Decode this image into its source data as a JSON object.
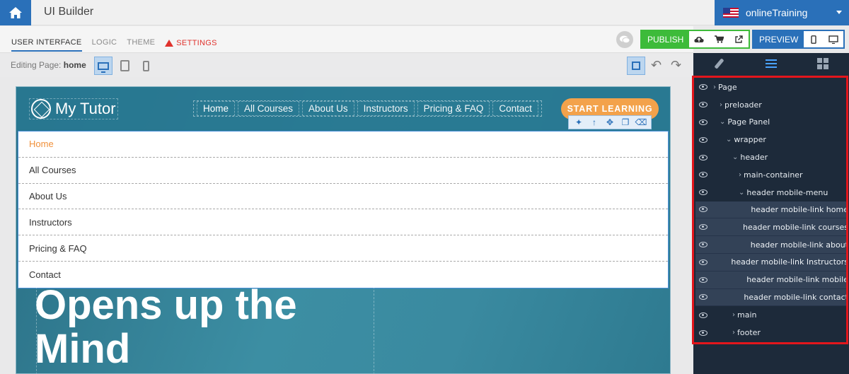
{
  "app": {
    "title": "UI Builder",
    "project": "onlineTraining"
  },
  "tabs": [
    {
      "label": "USER INTERFACE"
    },
    {
      "label": "LOGIC"
    },
    {
      "label": "THEME"
    },
    {
      "label": "SETTINGS"
    }
  ],
  "toolbar": {
    "publish_label": "PUBLISH",
    "preview_label": "PREVIEW"
  },
  "editing": {
    "prefix": "Editing Page:",
    "page": "home"
  },
  "site": {
    "brand": "My Tutor",
    "nav": [
      "Home",
      "All Courses",
      "About Us",
      "Instructors",
      "Pricing & FAQ",
      "Contact"
    ],
    "cta": "START LEARNING",
    "mobile_menu": [
      "Home",
      "All Courses",
      "About Us",
      "Instructors",
      "Pricing & FAQ",
      "Contact"
    ],
    "hero_line1": "Opens up the",
    "hero_line2": "Mind"
  },
  "tree": [
    {
      "label": "Page"
    },
    {
      "label": "preloader"
    },
    {
      "label": "Page Panel"
    },
    {
      "label": "wrapper"
    },
    {
      "label": "header"
    },
    {
      "label": "main-container"
    },
    {
      "label": "header mobile-menu"
    },
    {
      "label": "header mobile-link home"
    },
    {
      "label": "header mobile-link courses"
    },
    {
      "label": "header mobile-link about"
    },
    {
      "label": "header mobile-link Instructors"
    },
    {
      "label": "header mobile-link mobile"
    },
    {
      "label": "header mobile-link contact"
    },
    {
      "label": "main"
    },
    {
      "label": "footer"
    }
  ],
  "colors": {
    "brand_blue": "#2a70b9",
    "publish_green": "#3dbb3a",
    "accent_orange": "#f3a24b",
    "highlight_red": "#e3161c"
  }
}
